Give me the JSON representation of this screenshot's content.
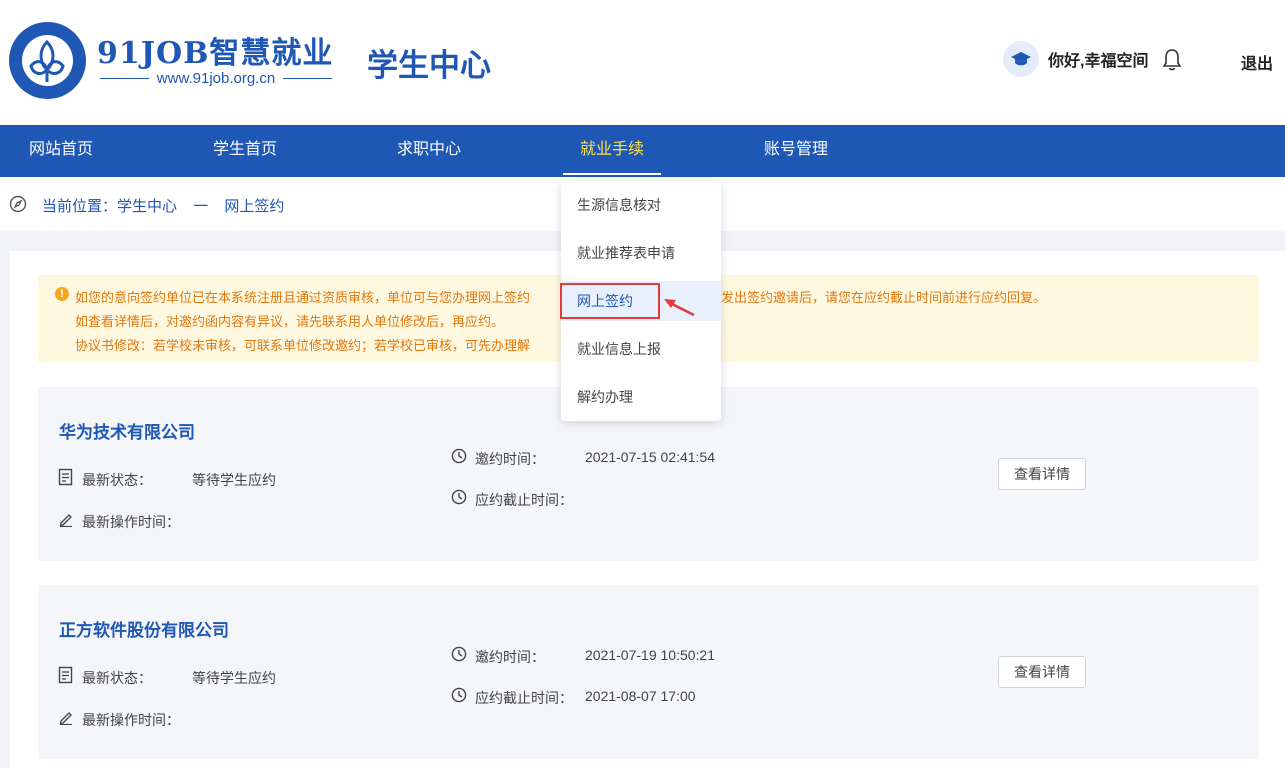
{
  "header": {
    "logo_title": "91JOB智慧就业",
    "logo_url": "www.91job.org.cn",
    "logo_ring_text": "91job智慧就业 www.91job.org.cn",
    "center_title": "学生中心",
    "greeting": "你好,幸福空间",
    "logout_label": "退出"
  },
  "nav": {
    "items": [
      {
        "label": "网站首页"
      },
      {
        "label": "学生首页"
      },
      {
        "label": "求职中心"
      },
      {
        "label": "就业手续"
      },
      {
        "label": "账号管理"
      }
    ],
    "active_index": 3
  },
  "breadcrumb": {
    "prefix": "当前位置：学生中心",
    "separator": "一",
    "current": "网上签约"
  },
  "notice": {
    "lines": [
      "如您的意向签约单位已在本系统注册且通过资质审核，单位可与您办理网上签约",
      "如查看详情后，对邀约函内容有异议，请先联系用人单位修改后，再应约。",
      "协议书修改：若学校未审核，可联系单位修改邀约；若学校已审核，可先办理解"
    ],
    "line1_tail": "发出签约邀请后，请您在应约截止时间前进行应约回复。"
  },
  "dropdown": {
    "items": [
      {
        "label": "生源信息核对"
      },
      {
        "label": "就业推荐表申请"
      },
      {
        "label": "网上签约"
      },
      {
        "label": "就业信息上报"
      },
      {
        "label": "解约办理"
      }
    ],
    "selected_index": 2
  },
  "labels": {
    "status": "最新状态：",
    "op_time": "最新操作时间：",
    "invite_time": "邀约时间：",
    "deadline": "应约截止时间：",
    "detail_button": "查看详情"
  },
  "cards": [
    {
      "company": "华为技术有限公司",
      "status": "等待学生应约",
      "op_time": "",
      "invite_time": "2021-07-15 02:41:54",
      "deadline": ""
    },
    {
      "company": "正方软件股份有限公司",
      "status": "等待学生应约",
      "op_time": "",
      "invite_time": "2021-07-19 10:50:21",
      "deadline": "2021-08-07 17:00"
    }
  ],
  "colors": {
    "brand": "#1f57b5",
    "nav_active": "#ffe04a",
    "notice_bg": "#fff8e1",
    "notice_text": "#e0780f",
    "highlight": "#e5393b"
  }
}
